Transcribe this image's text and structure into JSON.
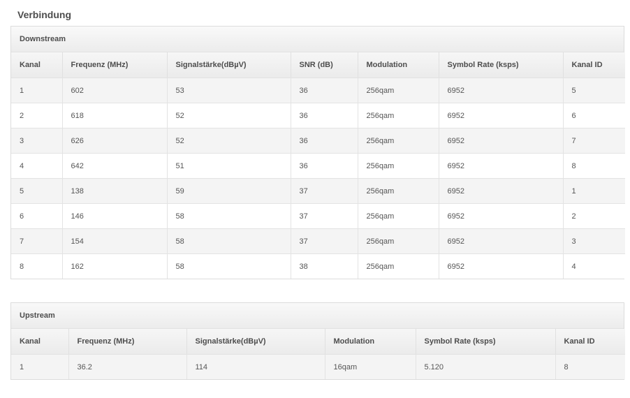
{
  "page": {
    "title": "Verbindung"
  },
  "downstream": {
    "title": "Downstream",
    "headers": [
      "Kanal",
      "Frequenz (MHz)",
      "Signalstärke(dBµV)",
      "SNR (dB)",
      "Modulation",
      "Symbol Rate (ksps)",
      "Kanal ID"
    ],
    "rows": [
      [
        "1",
        "602",
        "53",
        "36",
        "256qam",
        "6952",
        "5"
      ],
      [
        "2",
        "618",
        "52",
        "36",
        "256qam",
        "6952",
        "6"
      ],
      [
        "3",
        "626",
        "52",
        "36",
        "256qam",
        "6952",
        "7"
      ],
      [
        "4",
        "642",
        "51",
        "36",
        "256qam",
        "6952",
        "8"
      ],
      [
        "5",
        "138",
        "59",
        "37",
        "256qam",
        "6952",
        "1"
      ],
      [
        "6",
        "146",
        "58",
        "37",
        "256qam",
        "6952",
        "2"
      ],
      [
        "7",
        "154",
        "58",
        "37",
        "256qam",
        "6952",
        "3"
      ],
      [
        "8",
        "162",
        "58",
        "38",
        "256qam",
        "6952",
        "4"
      ]
    ]
  },
  "upstream": {
    "title": "Upstream",
    "headers": [
      "Kanal",
      "Frequenz (MHz)",
      "Signalstärke(dBµV)",
      "Modulation",
      "Symbol Rate (ksps)",
      "Kanal ID"
    ],
    "rows": [
      [
        "1",
        "36.2",
        "114",
        "16qam",
        "5.120",
        "8"
      ]
    ]
  }
}
